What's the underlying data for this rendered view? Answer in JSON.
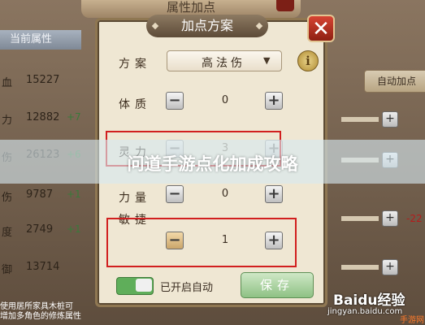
{
  "background": {
    "window_title": "属性加点",
    "tab_label": "当前属性",
    "stats": [
      {
        "key": "血",
        "value": "15227",
        "delta": ""
      },
      {
        "key": "力",
        "value": "12882",
        "delta": "+7"
      },
      {
        "key": "伤",
        "value": "26123",
        "delta": "+6"
      },
      {
        "key": "伤",
        "value": "9787",
        "delta": "+1"
      },
      {
        "key": "度",
        "value": "2749",
        "delta": "+1"
      },
      {
        "key": "御",
        "value": "13714",
        "delta": ""
      }
    ],
    "right_button": "自动加点",
    "right_rows": [
      {
        "delta": ""
      },
      {
        "delta": ""
      },
      {
        "delta": "-22"
      },
      {
        "delta": ""
      }
    ],
    "footer_lines": [
      "使用居所家具木桩可",
      "增加多角色的修炼属性"
    ]
  },
  "dialog": {
    "title": "加点方案",
    "close_glyph": "✕",
    "scheme_label": "方案",
    "scheme_value": "高法伤",
    "info_glyph": "i",
    "rows": [
      {
        "label": "体质",
        "value": "0"
      },
      {
        "label": "灵力",
        "value": "3"
      },
      {
        "label": "力量",
        "value": "0"
      },
      {
        "label": "敏捷",
        "value": "1"
      }
    ],
    "auto_toggle_label": "已开启自动",
    "auto_toggle_on": true,
    "save_label": "保存"
  },
  "overlay": {
    "title": "问道手游点化加成攻略"
  },
  "watermark": {
    "logo": "Baidu经验",
    "url": "jingyan.baidu.com",
    "corner": "手游网"
  },
  "colors": {
    "accent_green": "#5fae5a",
    "highlight_red": "#d11f1f",
    "close_red": "#c0392b"
  }
}
